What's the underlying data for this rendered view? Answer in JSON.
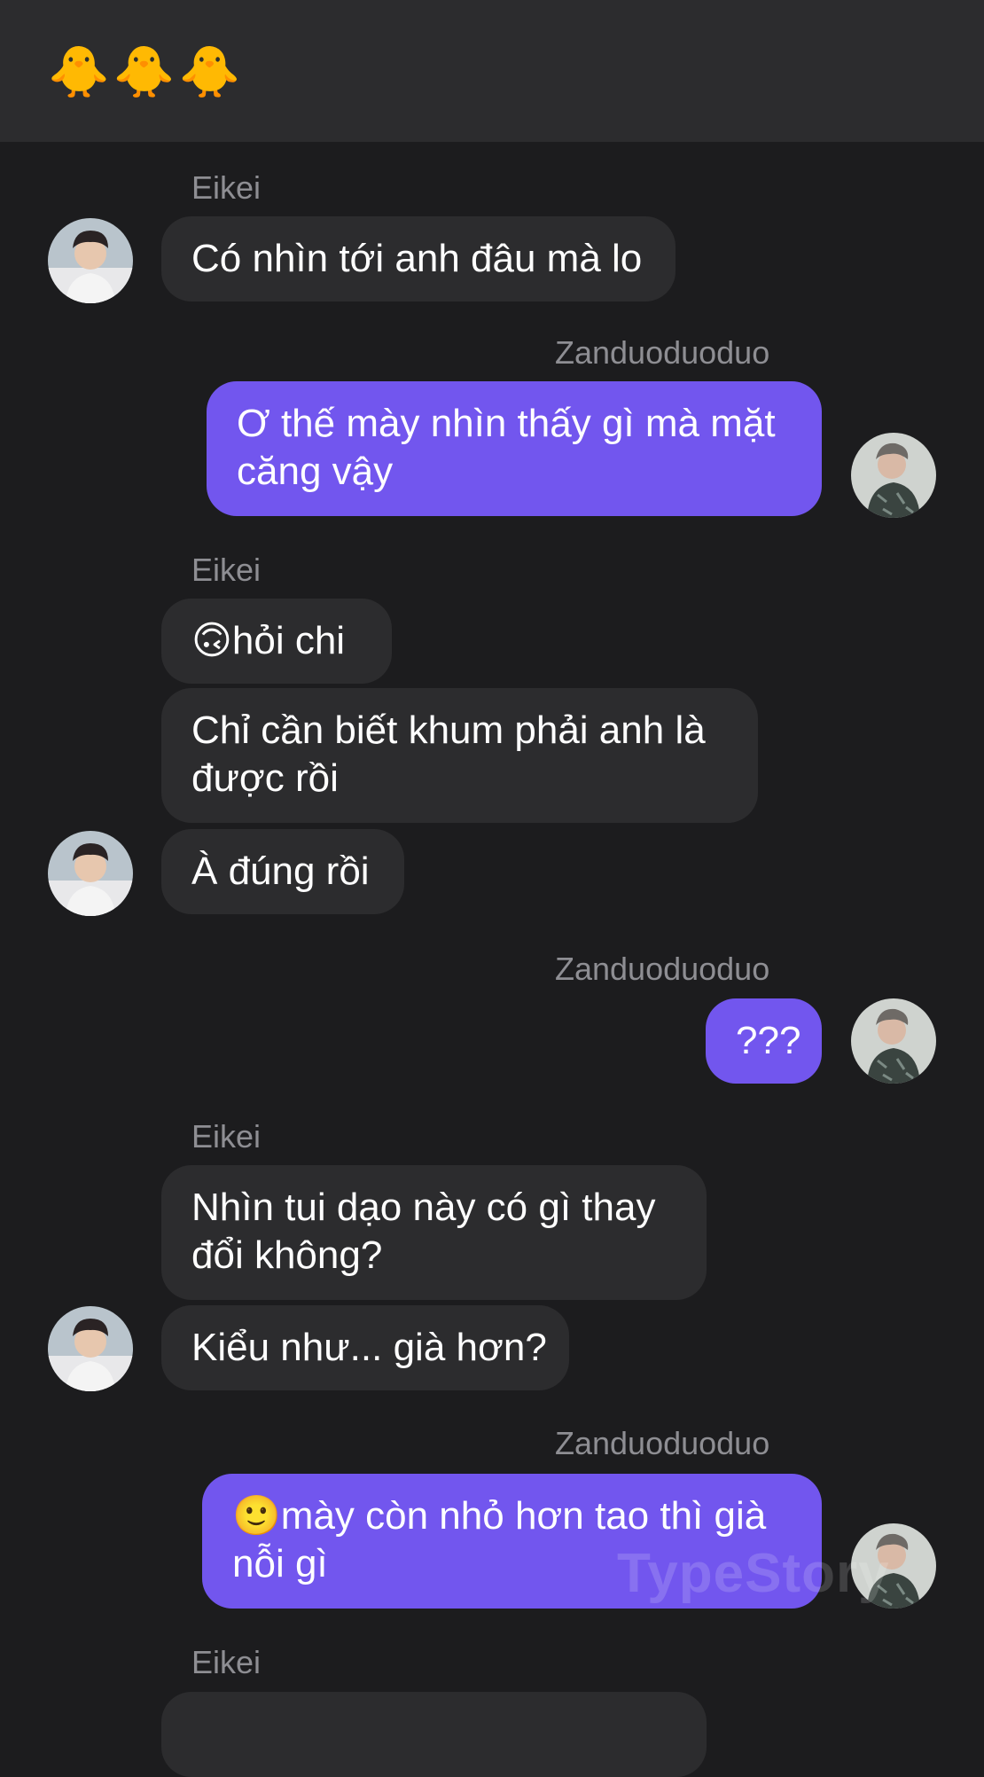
{
  "header": {
    "title": "🐥🐥🐥"
  },
  "participants": {
    "left_name": "Eikei",
    "right_name": "Zanduoduoduo"
  },
  "messages": [
    {
      "sender": "Eikei",
      "text": "Có nhìn tới anh đâu mà lo"
    },
    {
      "sender": "Zanduoduoduo",
      "line1": "Ơ thế mày nhìn thấy gì mà mặt",
      "line2": "căng vậy"
    },
    {
      "sender": "Eikei",
      "emoji": "🙃",
      "text": "hỏi chi"
    },
    {
      "sender": "Eikei",
      "line1": "Chỉ cần biết khum phải anh là",
      "line2": "được rồi"
    },
    {
      "sender": "Eikei",
      "text": "À đúng rồi"
    },
    {
      "sender": "Zanduoduoduo",
      "text": "???"
    },
    {
      "sender": "Eikei",
      "line1": "Nhìn tui dạo này có gì thay",
      "line2": "đổi không?"
    },
    {
      "sender": "Eikei",
      "text": "Kiểu như... già hơn?"
    },
    {
      "sender": "Zanduoduoduo",
      "emoji": "🙂",
      "line1": "mày còn nhỏ hơn tao thì già",
      "line2": "nỗi gì"
    }
  ],
  "avatars": {
    "left": "avatar-eikei",
    "right": "avatar-zanduoduoduo"
  },
  "watermark": "TypeStory",
  "colors": {
    "background": "#1c1c1e",
    "header": "#2c2c2e",
    "incoming_bubble": "#2c2c2e",
    "outgoing_bubble": "#7256ee",
    "name_text": "#8e8e93"
  }
}
